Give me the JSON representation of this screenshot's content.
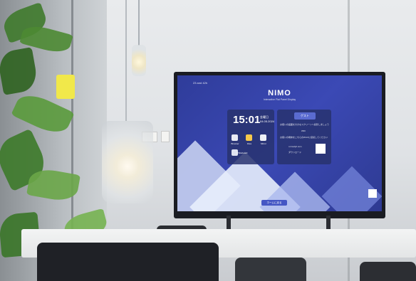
{
  "screen": {
    "top_left_text": "23 and 42h",
    "logo": "NIMO",
    "logo_subtitle": "Interactive Flat Panel Display",
    "time": "15:01",
    "weekday": "金曜日",
    "date": "04.05.2024",
    "apps": [
      "Browser",
      "Files",
      "Mirror",
      "Whiteboard"
    ],
    "right_button": "ゲスト",
    "right_line_1": "お使いの画面を大きなスクリーンへ投影しましょう",
    "right_line_2": "WiFi",
    "right_line_3": "お使いの端末をこちらのWi-Fiに接続してください",
    "link_text": "i.nimofyb.com",
    "link_subtext": "ダウンロード",
    "bottom_button": "ホームに戻る"
  }
}
